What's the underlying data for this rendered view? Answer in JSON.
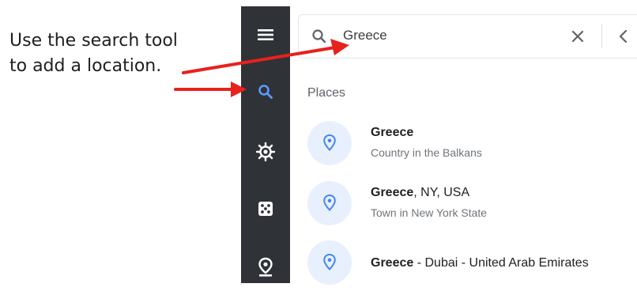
{
  "instruction": {
    "line1": "Use the search tool",
    "line2": "to add a location."
  },
  "rail": {
    "items": [
      {
        "name": "menu-icon",
        "active": false
      },
      {
        "name": "search-icon",
        "active": true
      },
      {
        "name": "compass-icon",
        "active": false
      },
      {
        "name": "dice-icon",
        "active": false
      },
      {
        "name": "location-pin-icon",
        "active": false
      }
    ]
  },
  "search": {
    "value": "Greece",
    "placeholder": ""
  },
  "places": {
    "title": "Places",
    "results": [
      {
        "bold": "Greece",
        "rest": "",
        "subtitle": "Country in the Balkans"
      },
      {
        "bold": "Greece",
        "rest": ", NY, USA",
        "subtitle": "Town in New York State"
      },
      {
        "bold": "Greece",
        "rest": " - Dubai - United Arab Emirates",
        "subtitle": ""
      }
    ]
  },
  "colors": {
    "rail_bg": "#2f3337",
    "accent": "#4285f4",
    "annotation_arrow": "#e8211d",
    "pin_bg": "#e8f0fe"
  }
}
